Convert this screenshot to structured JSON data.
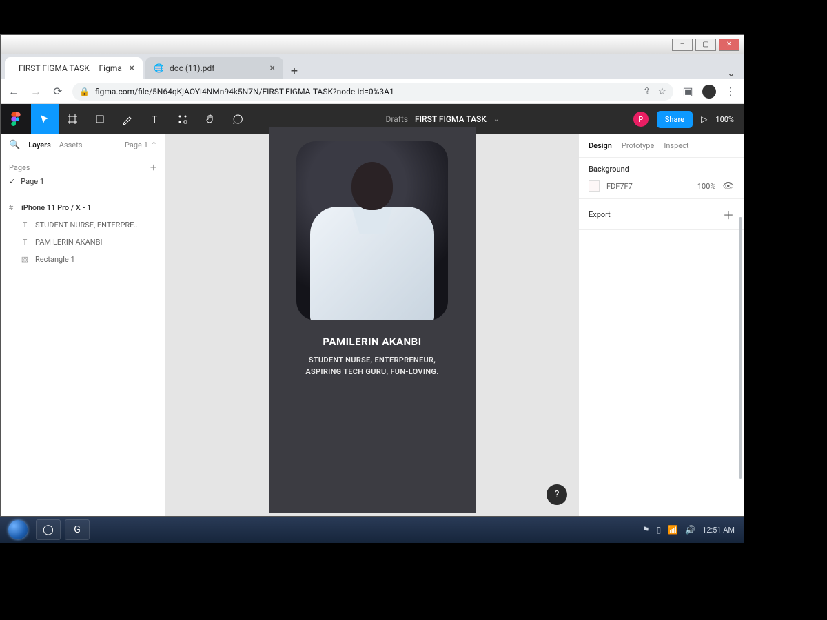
{
  "window": {
    "minimize": "–",
    "maximize": "▢",
    "close": "✕"
  },
  "browser": {
    "tabs": [
      {
        "title": "FIRST FIGMA TASK – Figma",
        "favicon": "figma"
      },
      {
        "title": "doc (11).pdf",
        "favicon": "globe"
      }
    ],
    "url": "figma.com/file/5N64qKjAOYi4NMn94k5N7N/FIRST-FIGMA-TASK?node-id=0%3A1"
  },
  "figma": {
    "toolbar": {
      "drafts": "Drafts",
      "file_title": "FIRST FIGMA TASK",
      "user_initial": "P",
      "share": "Share",
      "zoom": "100%"
    },
    "left": {
      "tab_layers": "Layers",
      "tab_assets": "Assets",
      "page_picker": "Page 1",
      "pages_label": "Pages",
      "page_items": [
        "Page 1"
      ],
      "frame": "iPhone 11 Pro / X - 1",
      "layers": [
        "STUDENT NURSE, ENTERPRE...",
        "PAMILERIN AKANBI",
        "Rectangle 1"
      ]
    },
    "canvas": {
      "name": "PAMILERIN AKANBI",
      "bio_line1": "STUDENT NURSE, ENTERPRENEUR,",
      "bio_line2": "ASPIRING TECH GURU, FUN-LOVING."
    },
    "right": {
      "tab_design": "Design",
      "tab_prototype": "Prototype",
      "tab_inspect": "Inspect",
      "background_label": "Background",
      "bg_hex": "FDF7F7",
      "bg_opacity": "100%",
      "export_label": "Export"
    }
  },
  "taskbar": {
    "clock": "12:51 AM"
  }
}
